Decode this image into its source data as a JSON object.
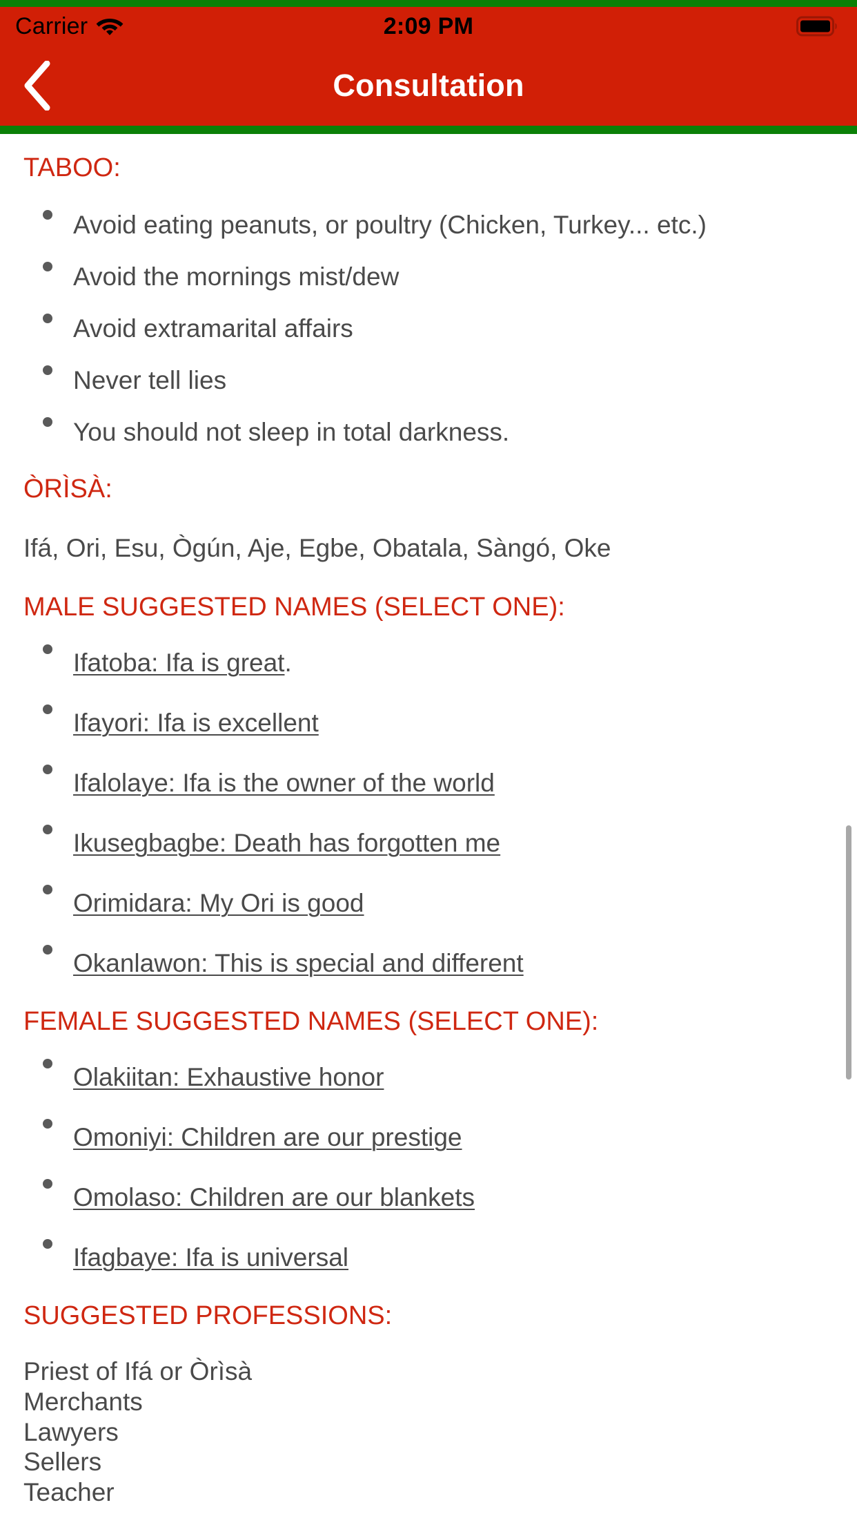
{
  "theme": {
    "primary_red": "#d11f06",
    "heading_red": "#cf2711",
    "accent_green": "#0b8007",
    "body_text": "#4a4a4a",
    "nav_title_color": "#ffffff"
  },
  "status_bar": {
    "carrier": "Carrier",
    "wifi_icon": "wifi-icon",
    "time": "2:09 PM",
    "battery_icon": "battery-full-icon"
  },
  "nav_bar": {
    "back_icon": "chevron-left-icon",
    "title": "Consultation"
  },
  "sections": {
    "taboo": {
      "heading": "TABOO:",
      "items": [
        "Avoid eating peanuts, or poultry (Chicken, Turkey... etc.)",
        "Avoid the mornings mist/dew",
        "Avoid extramarital affairs",
        "Never tell lies",
        "You should not sleep in total darkness."
      ]
    },
    "orisa": {
      "heading": "ÒRÌSÀ:",
      "text": "Ifá, Ori, Esu, Ògún, Aje, Egbe, Obatala, Sàngó, Oke"
    },
    "male_names": {
      "heading": "MALE SUGGESTED NAMES (SELECT ONE):",
      "items": [
        {
          "link": "Ifatoba: Ifa is great",
          "trailing": "."
        },
        {
          "link": "Ifayori: Ifa is excellent",
          "trailing": ""
        },
        {
          "link": "Ifalolaye: Ifa is the owner of the world",
          "trailing": ""
        },
        {
          "link": "Ikusegbagbe: Death has forgotten me",
          "trailing": ""
        },
        {
          "link": "Orimidara: My Ori is good",
          "trailing": ""
        },
        {
          "link": "Okanlawon: This is special and different",
          "trailing": ""
        }
      ]
    },
    "female_names": {
      "heading": "FEMALE SUGGESTED NAMES (SELECT ONE):",
      "items": [
        {
          "link": "Olakiitan: Exhaustive honor",
          "trailing": ""
        },
        {
          "link": "Omoniyi: Children are our prestige",
          "trailing": ""
        },
        {
          "link": "Omolaso: Children are our blankets",
          "trailing": ""
        },
        {
          "link": "Ifagbaye: Ifa is universal",
          "trailing": ""
        }
      ]
    },
    "professions": {
      "heading": "SUGGESTED PROFESSIONS:",
      "items": [
        "Priest of Ifá or Òrìsà",
        "Merchants",
        "Lawyers",
        "Sellers",
        "Teacher"
      ]
    }
  }
}
